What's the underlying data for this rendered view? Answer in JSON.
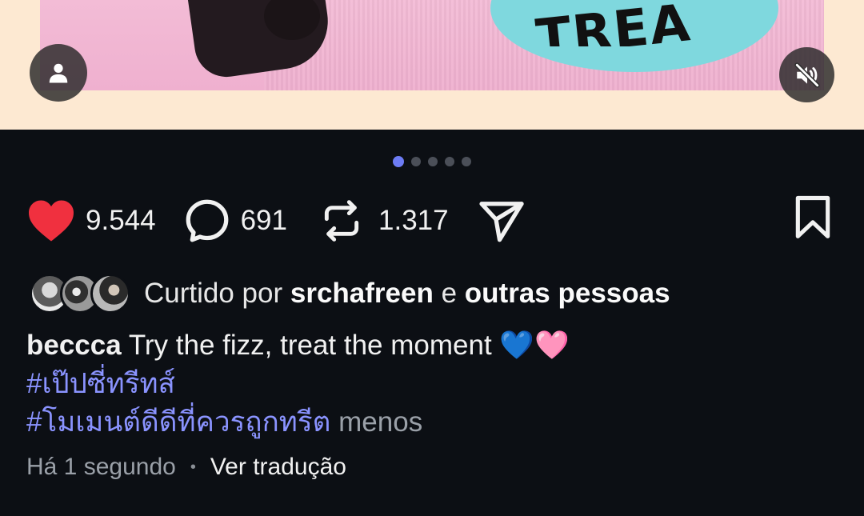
{
  "media": {
    "visible_text": "TREA",
    "pager": {
      "total": 5,
      "active": 0
    }
  },
  "actions": {
    "likes": "9.544",
    "comments": "691",
    "reposts": "1.317"
  },
  "liked_by": {
    "prefix": "Curtido por",
    "user": "srchafreen",
    "conjunction": "e",
    "others": "outras pessoas"
  },
  "post": {
    "username": "beccca",
    "caption": "Try the fizz, treat the moment 💙🩷",
    "hashtags": [
      "#เป๊ปซี่ทรีทส์",
      "#โมเมนต์ดีดีที่ควรถูกทรีต"
    ],
    "less_label": "menos",
    "timestamp": "Há 1 segundo",
    "translate_label": "Ver tradução"
  },
  "colors": {
    "background": "#0c0f14",
    "heart": "#f0303f",
    "hashtag": "#8a93ff",
    "pager_active": "#6d7cf5"
  },
  "icons": [
    "user-icon",
    "mute-icon",
    "heart-icon",
    "comment-icon",
    "repost-icon",
    "share-icon",
    "bookmark-icon"
  ]
}
